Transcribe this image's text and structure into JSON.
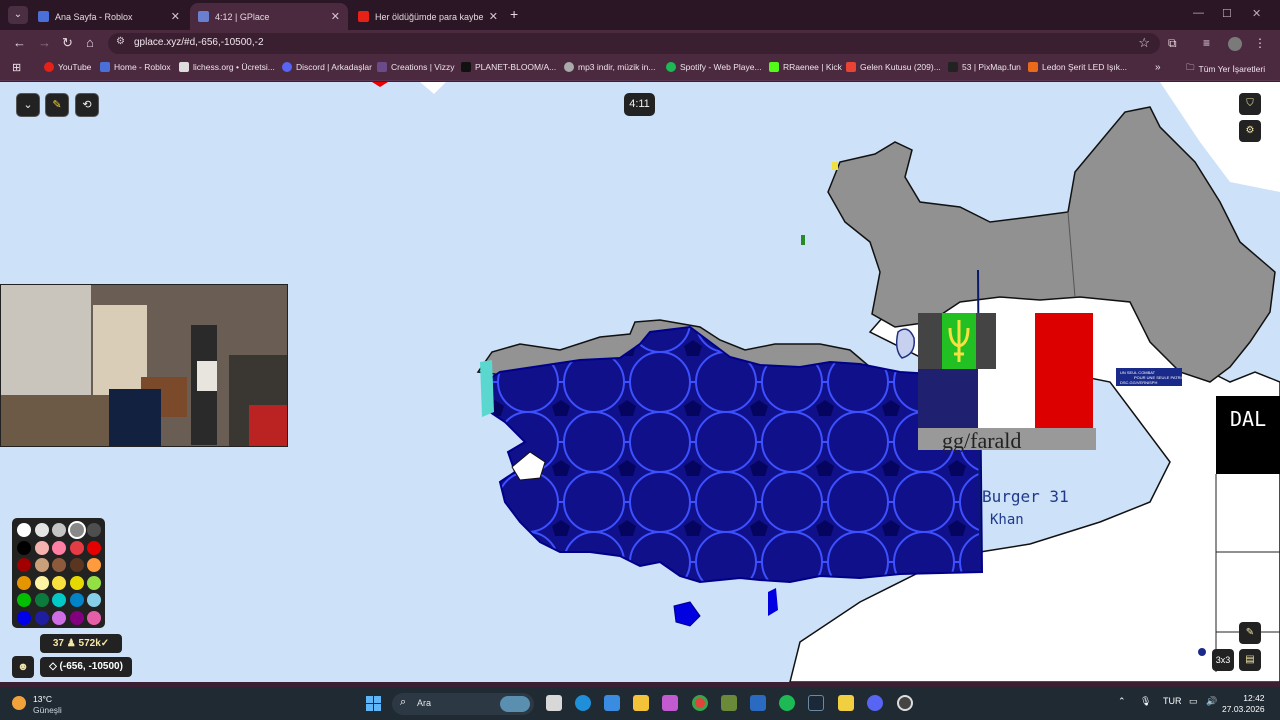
{
  "browser": {
    "tabs": [
      {
        "title": "Ana Sayfa - Roblox",
        "active": false
      },
      {
        "title": "4:12 | GPlace",
        "active": true
      },
      {
        "title": "Her öldüğümde para kaybediyo",
        "active": false
      }
    ],
    "url_display": "gplace.xyz/#d,-656,-10500,-2",
    "bookmarks": [
      {
        "label": "YouTube",
        "icon": "youtube-icon"
      },
      {
        "label": "Home - Roblox",
        "icon": "roblox-icon"
      },
      {
        "label": "lichess.org • Ücretsi...",
        "icon": "lichess-icon"
      },
      {
        "label": "Discord | Arkadaşlar",
        "icon": "discord-icon"
      },
      {
        "label": "Creations | Vizzy",
        "icon": "vizzy-icon"
      },
      {
        "label": "PLANET-BLOOM/A...",
        "icon": "github-icon"
      },
      {
        "label": "mp3 indir, müzik in...",
        "icon": "globe-icon"
      },
      {
        "label": "Spotify - Web Playe...",
        "icon": "spotify-icon"
      },
      {
        "label": "RRaenee | Kick",
        "icon": "kick-icon"
      },
      {
        "label": "Gelen Kutusu (209)...",
        "icon": "gmail-icon"
      },
      {
        "label": "53 | PixMap.fun",
        "icon": "pixmap-icon"
      },
      {
        "label": "Ledon Şerit LED Işık...",
        "icon": "ledon-icon"
      }
    ],
    "all_bookmarks_label": "Tüm Yer İşaretleri"
  },
  "game": {
    "timer": "4:11",
    "pixel_count": "37 ♟ 572k✓",
    "coordinates": "(-656, -10500)",
    "zoom_label": "3x3",
    "map_text": {
      "link": "gg/farald",
      "burger_line1": "Burger 31",
      "burger_line2": "Khan",
      "sign_line1": "UN SEUL COMBAT",
      "sign_line2": "POUR UNE SEULE PATRIE",
      "sign_line3": "DSC.GG/VERNISPH",
      "dal": "DAL"
    },
    "palette": [
      "#ffffff",
      "#e4e4e4",
      "#c4c4c4",
      "#888888",
      "#4e4e4e",
      "#000000",
      "#f4b3ae",
      "#ff7ea3",
      "#e53b44",
      "#e50000",
      "#a00000",
      "#c9a07a",
      "#8e5a3c",
      "#5a3620",
      "#ff9b3d",
      "#e59500",
      "#fff4a3",
      "#f8e13f",
      "#e5d900",
      "#94e044",
      "#02be01",
      "#0b7a3c",
      "#03c8c8",
      "#0083c7",
      "#86cfe8",
      "#0000ea",
      "#1e1e9e",
      "#cf6ee4",
      "#820080",
      "#e55ea8"
    ],
    "selected_color": "#888888"
  },
  "taskbar": {
    "temperature": "13°C",
    "weather_label": "Güneşli",
    "search_label": "Ara",
    "language": "TUR",
    "time": "12:42",
    "date": "27.03.2026"
  }
}
